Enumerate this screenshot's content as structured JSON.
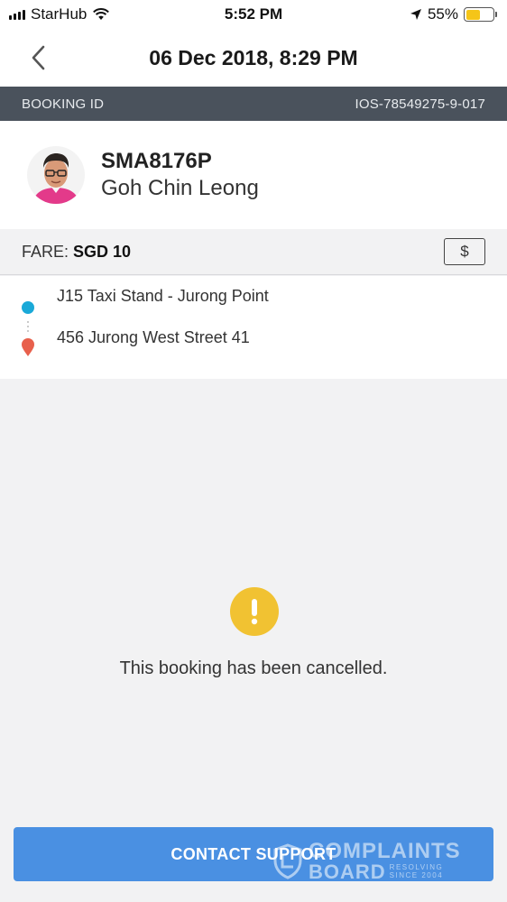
{
  "status_bar": {
    "carrier": "StarHub",
    "time": "5:52 PM",
    "battery": "55%",
    "battery_level": 0.55,
    "icons": [
      "signal-icon",
      "wifi-icon",
      "location-arrow-icon",
      "battery-icon"
    ]
  },
  "header": {
    "title": "06 Dec 2018, 8:29 PM",
    "back_icon": "chevron-left-icon"
  },
  "booking": {
    "label": "BOOKING ID",
    "id": "IOS-78549275-9-017"
  },
  "driver": {
    "plate": "SMA8176P",
    "name": "Goh Chin Leong"
  },
  "fare": {
    "label": "FARE:",
    "value": "SGD 10",
    "payment_icon": "$"
  },
  "route": {
    "pickup": "J15 Taxi Stand - Jurong Point",
    "dropoff": "456 Jurong West Street 41"
  },
  "status": {
    "message": "This booking has been cancelled."
  },
  "actions": {
    "contact_support": "CONTACT SUPPORT"
  },
  "watermark": {
    "line1": "COMPLAINTS",
    "line2": "BOARD",
    "sub1": "RESOLVING",
    "sub2": "SINCE 2004"
  },
  "colors": {
    "accent": "#4a90e2",
    "booking_bar": "#4a525c",
    "pickup": "#1aa9d8",
    "dropoff": "#e8604c",
    "warning": "#f1c232"
  }
}
